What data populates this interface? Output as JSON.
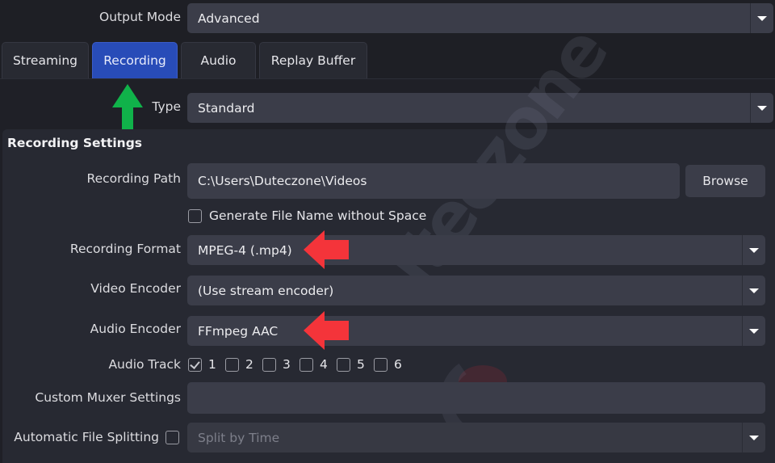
{
  "output_mode": {
    "label": "Output Mode",
    "value": "Advanced"
  },
  "tabs": [
    {
      "label": "Streaming",
      "active": false
    },
    {
      "label": "Recording",
      "active": true
    },
    {
      "label": "Audio",
      "active": false
    },
    {
      "label": "Replay Buffer",
      "active": false
    }
  ],
  "type": {
    "label": "Type",
    "value": "Standard"
  },
  "recording_settings": {
    "title": "Recording Settings",
    "recording_path": {
      "label": "Recording Path",
      "value": "C:\\Users\\Duteczone\\Videos",
      "browse_label": "Browse"
    },
    "generate_filename": {
      "label": "Generate File Name without Space",
      "checked": false
    },
    "recording_format": {
      "label": "Recording Format",
      "value": "MPEG-4 (.mp4)"
    },
    "video_encoder": {
      "label": "Video Encoder",
      "value": "(Use stream encoder)"
    },
    "audio_encoder": {
      "label": "Audio Encoder",
      "value": "FFmpeg AAC"
    },
    "audio_track": {
      "label": "Audio Track",
      "tracks": [
        {
          "label": "1",
          "checked": true
        },
        {
          "label": "2",
          "checked": false
        },
        {
          "label": "3",
          "checked": false
        },
        {
          "label": "4",
          "checked": false
        },
        {
          "label": "5",
          "checked": false
        },
        {
          "label": "6",
          "checked": false
        }
      ]
    },
    "custom_muxer": {
      "label": "Custom Muxer Settings",
      "value": ""
    },
    "auto_split": {
      "label": "Automatic File Splitting",
      "checked": false,
      "value": "Split by Time"
    }
  },
  "annotations": {
    "green_arrow_color": "#10b24a",
    "red_arrow_color": "#f4343a"
  },
  "watermark": {
    "text": "uteczone"
  }
}
